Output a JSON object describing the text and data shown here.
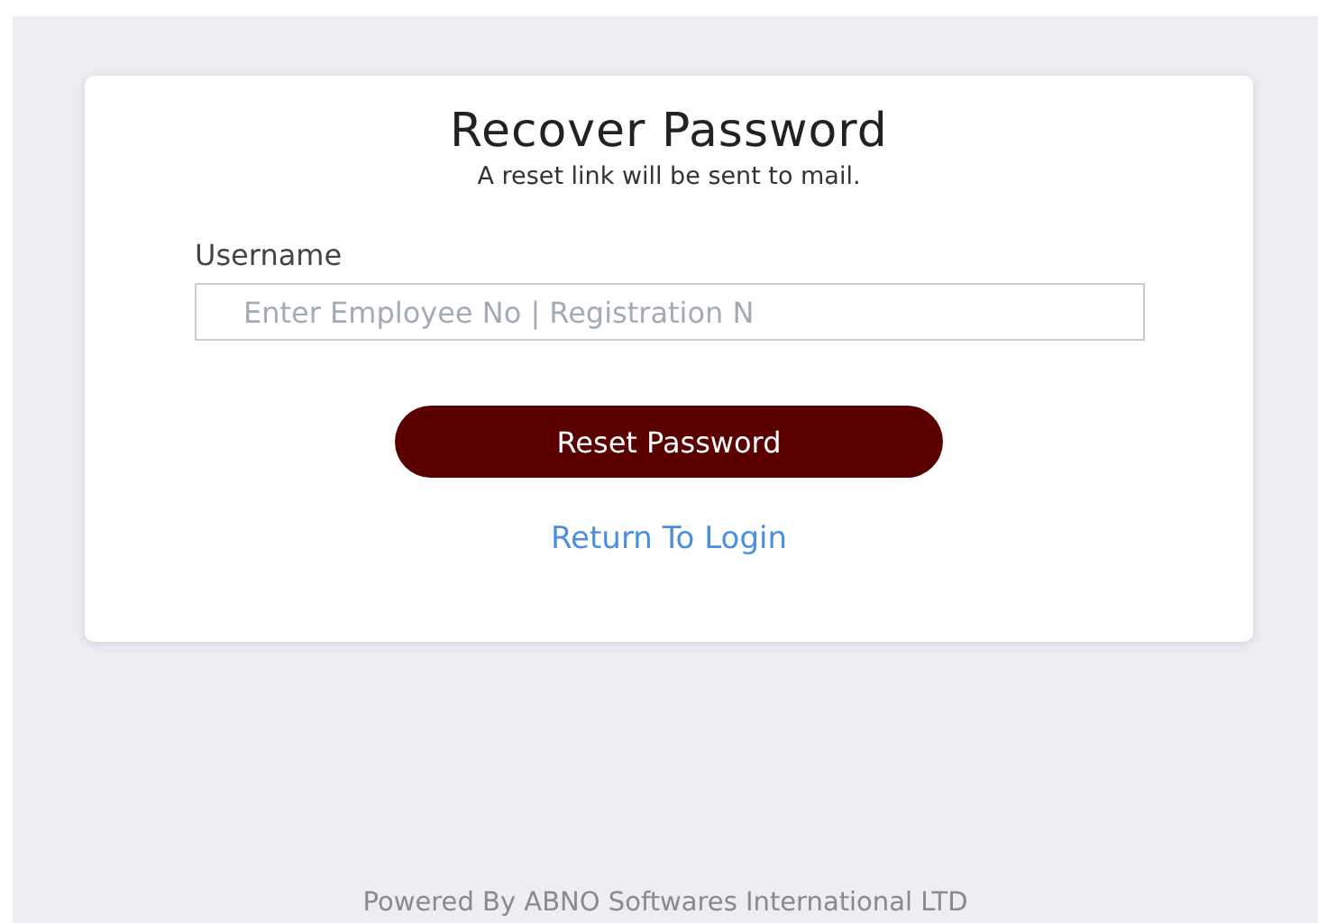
{
  "card": {
    "title": "Recover Password",
    "subtitle": "A reset link will be sent to mail.",
    "username": {
      "label": "Username",
      "placeholder": "Enter Employee No | Registration N"
    },
    "button": "Reset Password",
    "link": "Return To Login"
  },
  "footer": "Powered By ABNO Softwares International LTD"
}
